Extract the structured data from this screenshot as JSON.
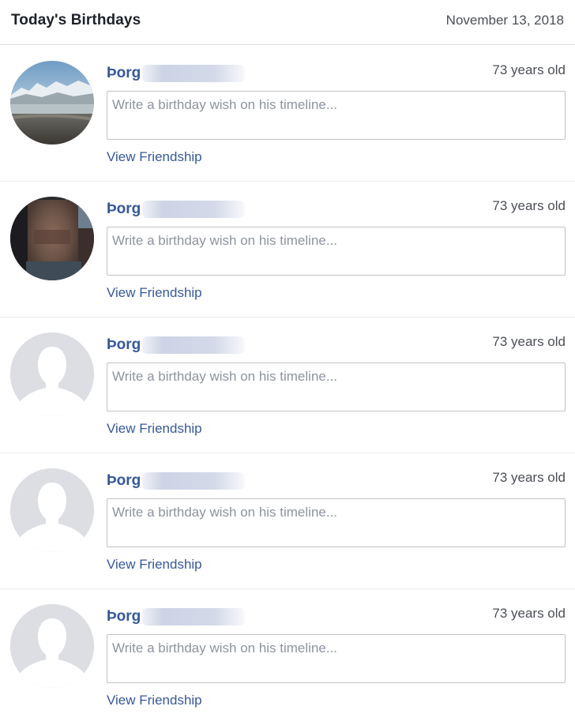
{
  "header": {
    "title": "Today's Birthdays",
    "date": "November 13, 2018"
  },
  "birthdays": [
    {
      "name": "Þorg",
      "age_label": "73 years old",
      "wish_placeholder": "Write a birthday wish on his timeline...",
      "view_label": "View Friendship",
      "avatar_icon": "landscape-photo"
    },
    {
      "name": "Þorg",
      "age_label": "73 years old",
      "wish_placeholder": "Write a birthday wish on his timeline...",
      "view_label": "View Friendship",
      "avatar_icon": "blurred-face-photo"
    },
    {
      "name": "Þorg",
      "age_label": "73 years old",
      "wish_placeholder": "Write a birthday wish on his timeline...",
      "view_label": "View Friendship",
      "avatar_icon": "default-person-silhouette"
    },
    {
      "name": "Þorg",
      "age_label": "73 years old",
      "wish_placeholder": "Write a birthday wish on his timeline...",
      "view_label": "View Friendship",
      "avatar_icon": "default-person-silhouette"
    },
    {
      "name": "Þorg",
      "age_label": "73 years old",
      "wish_placeholder": "Write a birthday wish on his timeline...",
      "view_label": "View Friendship",
      "avatar_icon": "default-person-silhouette"
    }
  ],
  "colors": {
    "link": "#365899",
    "border": "#bec3c9",
    "divider": "#e9ebee",
    "secondary_text": "#4b4f56",
    "placeholder": "#8d949e",
    "silhouette_bg": "#dcdee3"
  }
}
